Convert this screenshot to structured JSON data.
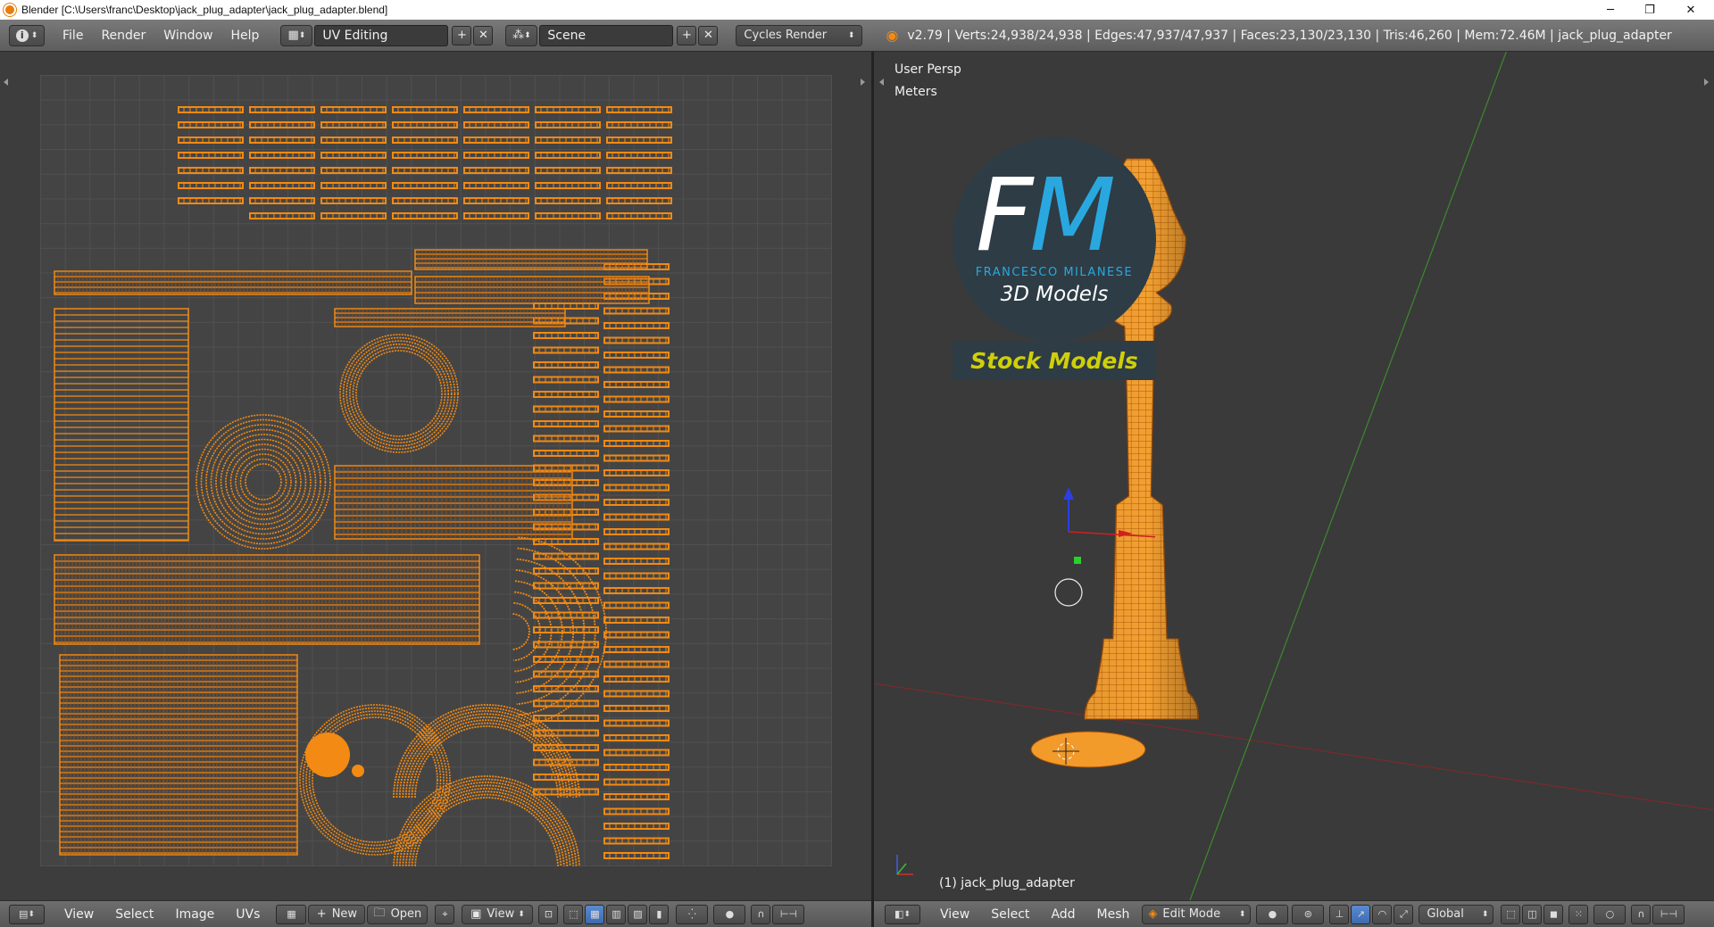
{
  "window": {
    "title": "Blender [C:\\Users\\franc\\Desktop\\jack_plug_adapter\\jack_plug_adapter.blend]",
    "controls": {
      "minimize": "─",
      "restore": "❐",
      "close": "✕"
    }
  },
  "infobar": {
    "menus": [
      "File",
      "Render",
      "Window",
      "Help"
    ],
    "screen_layout": "UV Editing",
    "scene": "Scene",
    "render_engine": "Cycles Render",
    "stats": "v2.79 | Verts:24,938/24,938 | Edges:47,937/47,937 | Faces:23,130/23,130 | Tris:46,260 | Mem:72.46M | jack_plug_adapter"
  },
  "viewport": {
    "view_name": "User Persp",
    "units": "Meters",
    "object_label": "(1) jack_plug_adapter",
    "logo": {
      "initials_f": "F",
      "initials_m": "M",
      "name": "FRANCESCO MILANESE",
      "subtitle": "3D Models",
      "badge": "Stock Models"
    }
  },
  "uv_header": {
    "menus": [
      "View",
      "Select",
      "Image",
      "UVs"
    ],
    "new_label": "New",
    "open_label": "Open",
    "view_label": "View"
  },
  "view3d_header": {
    "menus": [
      "View",
      "Select",
      "Add",
      "Mesh"
    ],
    "mode": "Edit Mode",
    "orientation": "Global"
  },
  "colors": {
    "accent_orange": "#f28a13",
    "mesh_wire": "#b4570a",
    "panel_bg": "#3d3d3d",
    "logo_blue": "#29a8e0",
    "logo_badge_text": "#d4d400"
  },
  "icons": [
    "info-icon",
    "uv-editor-icon",
    "layout-icon",
    "scene-icon",
    "blender-logo-icon",
    "mesh-cube-icon",
    "sphere-shading-icon",
    "pivot-icon",
    "manipulator-icon",
    "snap-magnet-icon"
  ]
}
